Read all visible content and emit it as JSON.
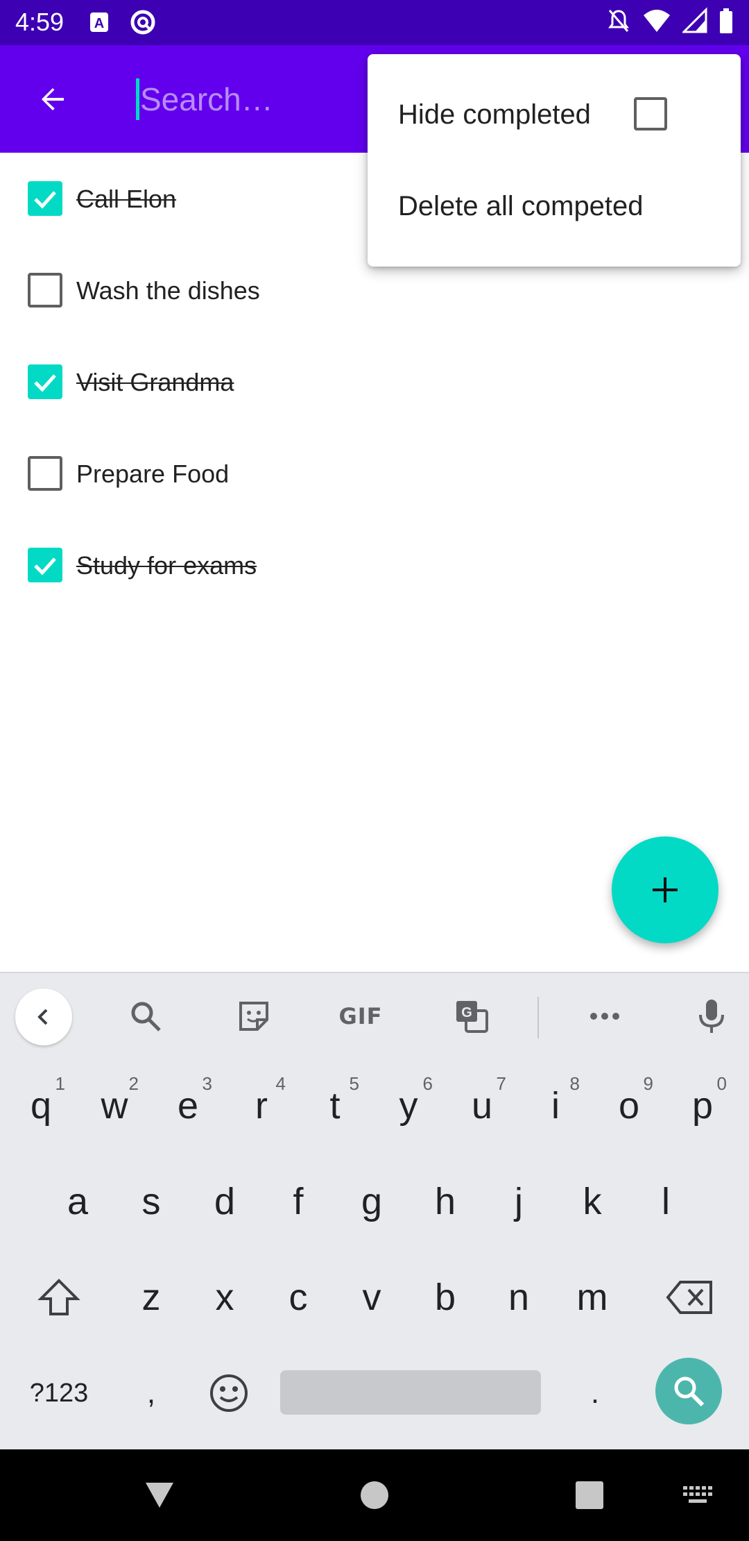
{
  "status_bar": {
    "time": "4:59",
    "left_icons": [
      "app-a-icon",
      "app-circle-icon"
    ],
    "right_icons": [
      "notifications-off-icon",
      "wifi-icon",
      "signal-icon",
      "battery-icon"
    ]
  },
  "app_bar": {
    "search_placeholder": "Search…",
    "search_value": "",
    "background": "#6200ee"
  },
  "menu": {
    "items": [
      {
        "label": "Hide completed",
        "has_checkbox": true,
        "checked": false
      },
      {
        "label": "Delete all competed"
      }
    ]
  },
  "tasks": [
    {
      "label": "Call Elon",
      "completed": true
    },
    {
      "label": "Wash the dishes",
      "completed": false
    },
    {
      "label": "Visit Grandma",
      "completed": true
    },
    {
      "label": "Prepare Food",
      "completed": false
    },
    {
      "label": "Study for exams",
      "completed": true
    }
  ],
  "fab": {
    "icon": "plus-icon",
    "color": "#03dac5"
  },
  "keyboard": {
    "toolbar": [
      "chevron-left-icon",
      "search-icon",
      "sticker-icon",
      "GIF",
      "translate-icon",
      "more-icon",
      "microphone-icon"
    ],
    "row1": [
      {
        "key": "q",
        "hint": "1"
      },
      {
        "key": "w",
        "hint": "2"
      },
      {
        "key": "e",
        "hint": "3"
      },
      {
        "key": "r",
        "hint": "4"
      },
      {
        "key": "t",
        "hint": "5"
      },
      {
        "key": "y",
        "hint": "6"
      },
      {
        "key": "u",
        "hint": "7"
      },
      {
        "key": "i",
        "hint": "8"
      },
      {
        "key": "o",
        "hint": "9"
      },
      {
        "key": "p",
        "hint": "0"
      }
    ],
    "row2": [
      "a",
      "s",
      "d",
      "f",
      "g",
      "h",
      "j",
      "k",
      "l"
    ],
    "row3": [
      "z",
      "x",
      "c",
      "v",
      "b",
      "n",
      "m"
    ],
    "row4": {
      "symbols": "?123",
      "comma": ",",
      "period": "."
    }
  },
  "nav_bar": [
    "back-triangle-icon",
    "home-circle-icon",
    "recents-square-icon",
    "keyboard-switch-icon"
  ],
  "colors": {
    "status_bar": "#3d00b2",
    "accent": "#03dac5",
    "primary": "#6200ee"
  }
}
